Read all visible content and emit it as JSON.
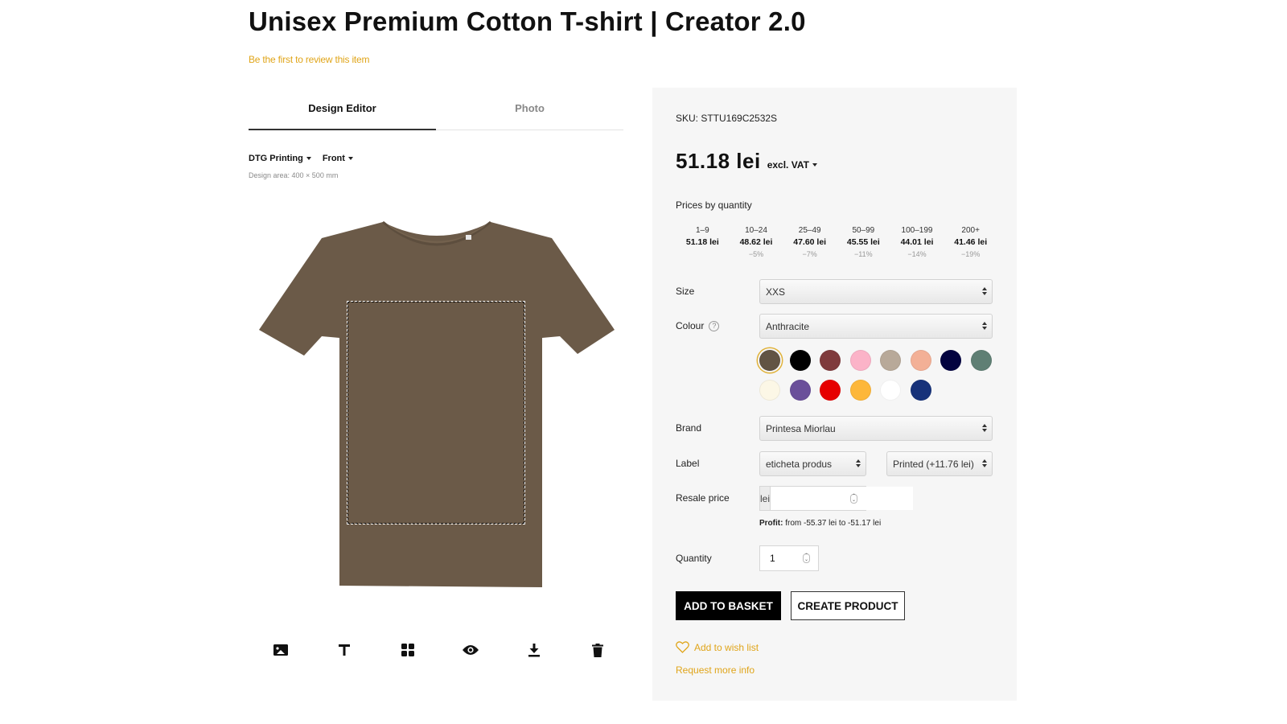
{
  "product": {
    "title": "Unisex Premium Cotton T-shirt | Creator 2.0",
    "review_link": "Be the first to review this item"
  },
  "tabs": [
    {
      "label": "Design Editor",
      "active": true
    },
    {
      "label": "Photo",
      "active": false
    }
  ],
  "editor": {
    "print_method": "DTG Printing",
    "side": "Front",
    "design_area": "Design area: 400 × 500 mm",
    "shirt_color": "#6b5a48",
    "toolbar": [
      {
        "name": "image-icon",
        "label": "Add image"
      },
      {
        "name": "text-icon",
        "label": "Add text"
      },
      {
        "name": "grid-icon",
        "label": "Templates"
      },
      {
        "name": "eye-icon",
        "label": "Preview"
      },
      {
        "name": "download-icon",
        "label": "Download"
      },
      {
        "name": "trash-icon",
        "label": "Delete"
      }
    ]
  },
  "panel": {
    "sku": "SKU: STTU169C2532S",
    "price": "51.18 lei",
    "vat_label": "excl. VAT",
    "prices_by_quantity_title": "Prices by quantity",
    "tiers": [
      {
        "range": "1–9",
        "price": "51.18 lei",
        "discount": ""
      },
      {
        "range": "10–24",
        "price": "48.62 lei",
        "discount": "−5%"
      },
      {
        "range": "25–49",
        "price": "47.60 lei",
        "discount": "−7%"
      },
      {
        "range": "50–99",
        "price": "45.55 lei",
        "discount": "−11%"
      },
      {
        "range": "100–199",
        "price": "44.01 lei",
        "discount": "−14%"
      },
      {
        "range": "200+",
        "price": "41.46 lei",
        "discount": "−19%"
      }
    ],
    "size": {
      "label": "Size",
      "value": "XXS"
    },
    "colour": {
      "label": "Colour",
      "help": "?",
      "value": "Anthracite"
    },
    "swatches": [
      {
        "color": "#625444",
        "selected": true
      },
      {
        "color": "#000000",
        "selected": false
      },
      {
        "color": "#7f3a3c",
        "selected": false
      },
      {
        "color": "#fbb3c8",
        "selected": false
      },
      {
        "color": "#b8a999",
        "selected": false
      },
      {
        "color": "#f3b096",
        "selected": false
      },
      {
        "color": "#030340",
        "selected": false
      },
      {
        "color": "#5f7f74",
        "selected": false
      },
      {
        "color": "#fcf7e6",
        "selected": false
      },
      {
        "color": "#6a4f9a",
        "selected": false
      },
      {
        "color": "#e60000",
        "selected": false
      },
      {
        "color": "#fdb73a",
        "selected": false
      },
      {
        "color": "#ffffff",
        "selected": false
      },
      {
        "color": "#17327a",
        "selected": false
      }
    ],
    "brand": {
      "label": "Brand",
      "value": "Printesa Miorlau"
    },
    "label": {
      "label": "Label",
      "value": "eticheta produs",
      "option": "Printed (+11.76 lei)"
    },
    "resale": {
      "label": "Resale price",
      "currency": "lei",
      "value": "",
      "profit_label": "Profit:",
      "profit_text": " from -55.37 lei to -51.17 lei"
    },
    "quantity": {
      "label": "Quantity",
      "value": "1"
    },
    "add_to_basket": "ADD TO BASKET",
    "create_product": "CREATE PRODUCT",
    "wish_list": "Add to wish list",
    "request_info": "Request more info",
    "accent_color": "#e0a51a"
  }
}
